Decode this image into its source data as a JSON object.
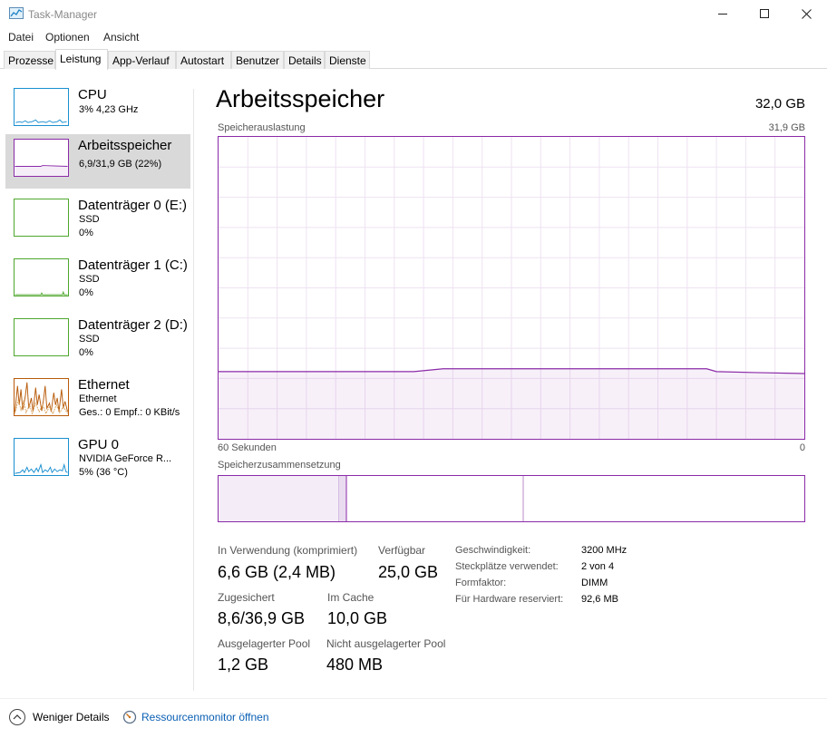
{
  "window": {
    "title": "Task-Manager"
  },
  "menu": [
    "Datei",
    "Optionen",
    "Ansicht"
  ],
  "tabs": [
    "Prozesse",
    "Leistung",
    "App-Verlauf",
    "Autostart",
    "Benutzer",
    "Details",
    "Dienste"
  ],
  "active_tab": "Leistung",
  "sidebar": {
    "cpu": {
      "title": "CPU",
      "line1": "3%  4,23 GHz"
    },
    "memory": {
      "title": "Arbeitsspeicher",
      "line1": "6,9/31,9 GB (22%)"
    },
    "disk0": {
      "title": "Datenträger 0 (E:)",
      "line1": "SSD",
      "line2": "0%"
    },
    "disk1": {
      "title": "Datenträger 1 (C:)",
      "line1": "SSD",
      "line2": "0%"
    },
    "disk2": {
      "title": "Datenträger 2 (D:)",
      "line1": "SSD",
      "line2": "0%"
    },
    "ethernet": {
      "title": "Ethernet",
      "line1": "Ethernet",
      "line2": "Ges.: 0  Empf.: 0 KBit/s"
    },
    "gpu": {
      "title": "GPU 0",
      "line1": "NVIDIA GeForce R...",
      "line2": "5%  (36 °C)"
    }
  },
  "main": {
    "title": "Arbeitsspeicher",
    "total": "32,0 GB",
    "usage_label": "Speicherauslastung",
    "usage_max": "31,9 GB",
    "time_left": "60 Sekunden",
    "time_right": "0",
    "composition_label": "Speicherzusammensetzung"
  },
  "chart_data": {
    "type": "area",
    "title": "Speicherauslastung",
    "xlabel": "",
    "ylabel": "",
    "x": [
      60,
      49,
      40,
      37,
      30,
      20,
      10,
      9,
      5,
      0
    ],
    "values": [
      7.1,
      7.1,
      7.1,
      7.4,
      7.4,
      7.4,
      7.4,
      7.1,
      7.0,
      6.9
    ],
    "xlim": [
      60,
      0
    ],
    "ylim": [
      0,
      31.9
    ]
  },
  "stats": {
    "in_use_label": "In Verwendung (komprimiert)",
    "in_use_value": "6,6 GB (2,4 MB)",
    "available_label": "Verfügbar",
    "available_value": "25,0 GB",
    "committed_label": "Zugesichert",
    "committed_value": "8,6/36,9 GB",
    "cached_label": "Im Cache",
    "cached_value": "10,0 GB",
    "paged_label": "Ausgelagerter Pool",
    "paged_value": "1,2 GB",
    "nonpaged_label": "Nicht ausgelagerter Pool",
    "nonpaged_value": "480 MB"
  },
  "details": [
    {
      "label": "Geschwindigkeit:",
      "value": "3200 MHz"
    },
    {
      "label": "Steckplätze verwendet:",
      "value": "2 von 4"
    },
    {
      "label": "Formfaktor:",
      "value": "DIMM"
    },
    {
      "label": "Für Hardware reserviert:",
      "value": "92,6 MB"
    }
  ],
  "footer": {
    "fewer_details": "Weniger Details",
    "resource_monitor": "Ressourcenmonitor öffnen"
  },
  "colors": {
    "memory": "#8b2aa8",
    "cpu": "#1a8fd0",
    "disk": "#4ea72e",
    "ethernet": "#b85a0a",
    "link": "#0a5fb4"
  }
}
